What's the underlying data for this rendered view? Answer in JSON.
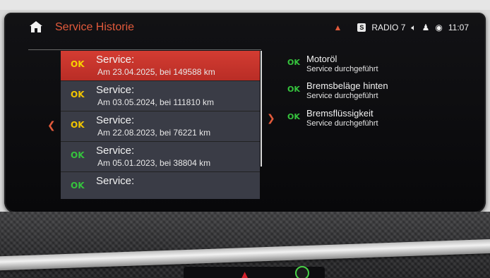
{
  "header": {
    "title": "Service Historie",
    "source_badge": "S",
    "radio_label": "RADIO 7",
    "time": "11:07"
  },
  "list": [
    {
      "ok": "OK",
      "title": "Service:",
      "detail": "Am 23.04.2025, bei 149588 km",
      "selected": true
    },
    {
      "ok": "OK",
      "title": "Service:",
      "detail": "Am 03.05.2024, bei 111810 km"
    },
    {
      "ok": "OK",
      "title": "Service:",
      "detail": "Am 22.08.2023, bei 76221 km"
    },
    {
      "ok": "OK",
      "title": "Service:",
      "detail": "Am 05.01.2023, bei 38804 km"
    },
    {
      "ok": "OK",
      "title": "Service:",
      "detail": ""
    }
  ],
  "details": [
    {
      "ok": "OK",
      "name": "Motoröl",
      "status": "Service durchgeführt"
    },
    {
      "ok": "OK",
      "name": "Bremsbeläge hinten",
      "status": "Service durchgeführt"
    },
    {
      "ok": "OK",
      "name": "Bremsflüssigkeit",
      "status": "Service durchgeführt"
    }
  ],
  "icons": {
    "home": "home-icon",
    "scroll_up": "chevron-up-icon",
    "volume": "speaker-icon",
    "profile": "person-icon",
    "connectivity": "phone-connection-icon",
    "nav_left": "chevron-left-icon",
    "nav_right": "chevron-right-icon"
  },
  "colors": {
    "accent": "#e25a3b",
    "ok_yellow": "#f2c500",
    "ok_green": "#35c43d",
    "selected_row": "#c9352d"
  }
}
